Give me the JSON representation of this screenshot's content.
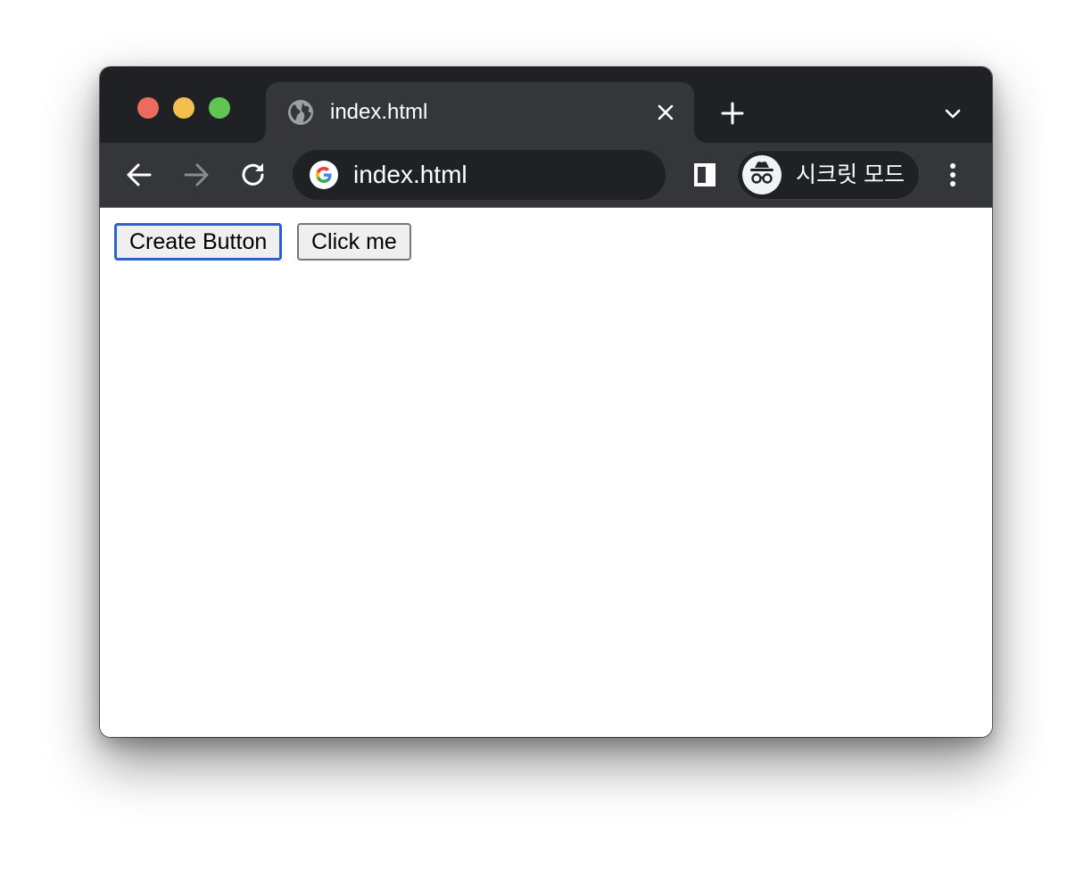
{
  "browser": {
    "tab": {
      "title": "index.html",
      "favicon": "globe-icon",
      "close_icon": "close-icon"
    },
    "new_tab_icon": "plus-icon",
    "tab_search_icon": "chevron-down-icon",
    "toolbar": {
      "back_icon": "arrow-left-icon",
      "forward_icon": "arrow-right-icon",
      "reload_icon": "reload-icon",
      "omnibox": {
        "icon": "google-icon",
        "url": "index.html"
      },
      "side_panel_icon": "side-panel-icon",
      "profile": {
        "icon": "incognito-icon",
        "label": "시크릿 모드"
      },
      "menu_icon": "more-vertical-icon"
    },
    "colors": {
      "tab_strip": "#202124",
      "toolbar": "#35363a",
      "omnibox": "#202124",
      "focus_ring": "#2b62cc"
    }
  },
  "page": {
    "buttons": [
      {
        "label": "Create Button",
        "focused": true
      },
      {
        "label": "Click me",
        "focused": false
      }
    ]
  }
}
